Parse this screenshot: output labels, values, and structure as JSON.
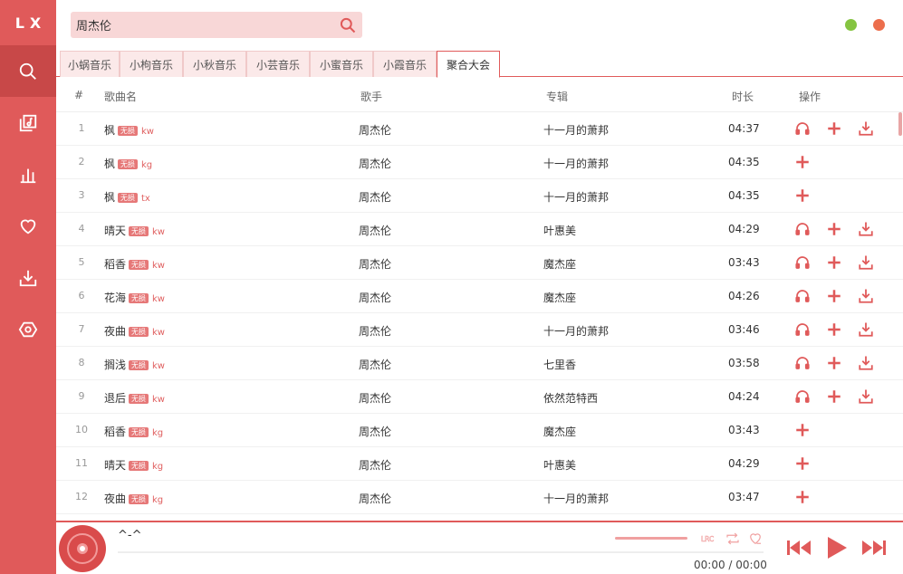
{
  "app": {
    "logo": "LX"
  },
  "sidebar": {
    "items": [
      {
        "name": "search",
        "active": true
      },
      {
        "name": "music"
      },
      {
        "name": "charts"
      },
      {
        "name": "favorites"
      },
      {
        "name": "downloads"
      },
      {
        "name": "settings"
      }
    ]
  },
  "search": {
    "value": "周杰伦"
  },
  "tabs": [
    {
      "label": "小蜗音乐"
    },
    {
      "label": "小枸音乐"
    },
    {
      "label": "小秋音乐"
    },
    {
      "label": "小芸音乐"
    },
    {
      "label": "小蜜音乐"
    },
    {
      "label": "小霞音乐"
    },
    {
      "label": "聚合大会",
      "active": true
    }
  ],
  "table": {
    "headers": {
      "index": "#",
      "name": "歌曲名",
      "artist": "歌手",
      "album": "专辑",
      "duration": "时长",
      "actions": "操作"
    },
    "badge_text": "无损",
    "rows": [
      {
        "index": "1",
        "name": "枫",
        "source": "kw",
        "artist": "周杰伦",
        "album": "十一月的萧邦",
        "duration": "04:37",
        "listen": true,
        "download": true
      },
      {
        "index": "2",
        "name": "枫",
        "source": "kg",
        "artist": "周杰伦",
        "album": "十一月的萧邦",
        "duration": "04:35",
        "listen": false,
        "download": false
      },
      {
        "index": "3",
        "name": "枫",
        "source": "tx",
        "artist": "周杰伦",
        "album": "十一月的萧邦",
        "duration": "04:35",
        "listen": false,
        "download": false
      },
      {
        "index": "4",
        "name": "晴天",
        "source": "kw",
        "artist": "周杰伦",
        "album": "叶惠美",
        "duration": "04:29",
        "listen": true,
        "download": true
      },
      {
        "index": "5",
        "name": "稻香",
        "source": "kw",
        "artist": "周杰伦",
        "album": "魔杰座",
        "duration": "03:43",
        "listen": true,
        "download": true
      },
      {
        "index": "6",
        "name": "花海",
        "source": "kw",
        "artist": "周杰伦",
        "album": "魔杰座",
        "duration": "04:26",
        "listen": true,
        "download": true
      },
      {
        "index": "7",
        "name": "夜曲",
        "source": "kw",
        "artist": "周杰伦",
        "album": "十一月的萧邦",
        "duration": "03:46",
        "listen": true,
        "download": true
      },
      {
        "index": "8",
        "name": "搁浅",
        "source": "kw",
        "artist": "周杰伦",
        "album": "七里香",
        "duration": "03:58",
        "listen": true,
        "download": true
      },
      {
        "index": "9",
        "name": "退后",
        "source": "kw",
        "artist": "周杰伦",
        "album": "依然范特西",
        "duration": "04:24",
        "listen": true,
        "download": true
      },
      {
        "index": "10",
        "name": "稻香",
        "source": "kg",
        "artist": "周杰伦",
        "album": "魔杰座",
        "duration": "03:43",
        "listen": false,
        "download": false
      },
      {
        "index": "11",
        "name": "晴天",
        "source": "kg",
        "artist": "周杰伦",
        "album": "叶惠美",
        "duration": "04:29",
        "listen": false,
        "download": false
      },
      {
        "index": "12",
        "name": "夜曲",
        "source": "kg",
        "artist": "周杰伦",
        "album": "十一月的萧邦",
        "duration": "03:47",
        "listen": false,
        "download": false
      }
    ]
  },
  "player": {
    "title": "^-^",
    "time": "00:00 / 00:00",
    "lyric_label": "LRC"
  },
  "colors": {
    "accent": "#e05a5a",
    "minimize": "#85c441",
    "close": "#ec6e4c"
  }
}
